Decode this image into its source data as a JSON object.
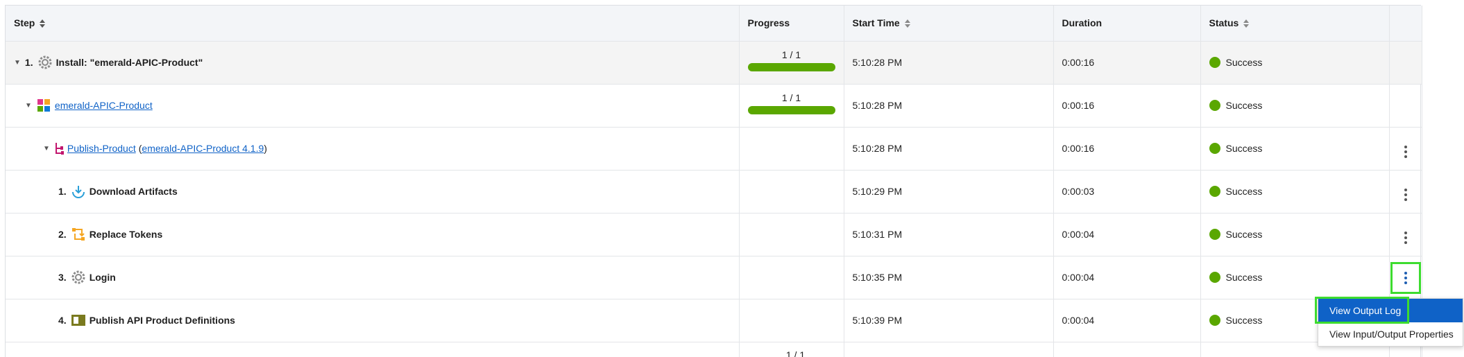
{
  "header": {
    "step": "Step",
    "progress": "Progress",
    "start_time": "Start Time",
    "duration": "Duration",
    "status": "Status"
  },
  "rows": [
    {
      "number": "1.",
      "name": "Install: \"emerald-APIC-Product\"",
      "progress": "1 / 1",
      "progress_fraction": 1.0,
      "start_time": "5:10:28 PM",
      "duration": "0:00:16",
      "status": "Success"
    },
    {
      "name": "emerald-APIC-Product",
      "progress": "1 / 1",
      "progress_fraction": 1.0,
      "start_time": "5:10:28 PM",
      "duration": "0:00:16",
      "status": "Success"
    },
    {
      "name": "Publish-Product",
      "open_paren": "(",
      "version_link": "emerald-APIC-Product 4.1.9",
      "close_paren": ")",
      "start_time": "5:10:28 PM",
      "duration": "0:00:16",
      "status": "Success"
    },
    {
      "number": "1.",
      "name": "Download Artifacts",
      "start_time": "5:10:29 PM",
      "duration": "0:00:03",
      "status": "Success"
    },
    {
      "number": "2.",
      "name": "Replace Tokens",
      "start_time": "5:10:31 PM",
      "duration": "0:00:04",
      "status": "Success"
    },
    {
      "number": "3.",
      "name": "Login",
      "start_time": "5:10:35 PM",
      "duration": "0:00:04",
      "status": "Success"
    },
    {
      "number": "4.",
      "name": "Publish API Product Definitions",
      "start_time": "5:10:39 PM",
      "duration": "0:00:04",
      "status": "Success"
    }
  ],
  "partial_row": {
    "progress": "1 / 1"
  },
  "context_menu": {
    "items": [
      "View Output Log",
      "View Input/Output Properties"
    ]
  },
  "colors": {
    "success": "#5aa700",
    "link": "#0f62c7",
    "menu_active": "#0f62c7",
    "highlight": "#3ddc2f"
  },
  "icons": {
    "row1": "gear-icon",
    "row2": "component-icon",
    "row3": "process-icon",
    "row4": "download-icon",
    "row5": "replace-tokens-icon",
    "row6": "gear-icon",
    "row7": "publish-icon"
  }
}
